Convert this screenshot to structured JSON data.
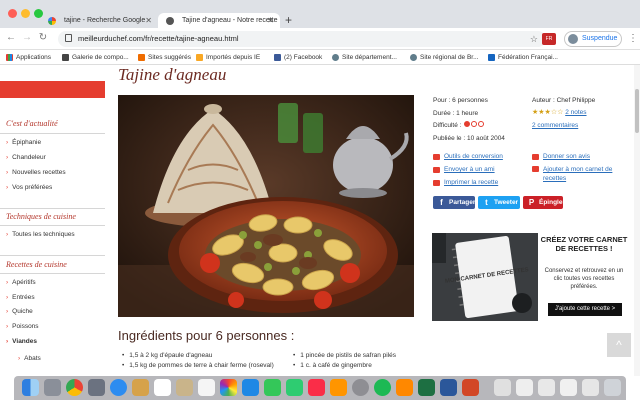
{
  "browser": {
    "tabs": [
      {
        "title": "tajine - Recherche Google",
        "active": false
      },
      {
        "title": "Tajine d'agneau - Notre recette",
        "active": true
      }
    ],
    "new_tab": "+",
    "url": "meilleurduchef.com/fr/recette/tajine-agneau.html",
    "profile_label": "Suspendue",
    "extension_badge": "FR",
    "bookmarks": [
      "Applications",
      "Galerie de compo...",
      "Sites suggérés",
      "Importés depuis IE",
      "(2) Facebook",
      "Site département...",
      "Site régional de Br...",
      "Fédération Françai..."
    ]
  },
  "sidebar": {
    "sections": [
      {
        "title": "C'est d'actualité",
        "items": [
          "Épiphanie",
          "Chandeleur",
          "Nouvelles recettes",
          "Vos préférées"
        ]
      },
      {
        "title": "Techniques de cuisine",
        "items": [
          "Toutes les techniques"
        ]
      },
      {
        "title": "Recettes de cuisine",
        "items": [
          "Apéritifs",
          "Entrées",
          "Quiche",
          "Poissons",
          "Viandes"
        ],
        "subitems": [
          "Abats"
        ]
      }
    ]
  },
  "recipe": {
    "title": "Tajine d'agneau",
    "servings": "Pour : 6 personnes",
    "duration": "Durée : 1 heure",
    "difficulty_label": "Difficulté :",
    "difficulty_level": 1,
    "difficulty_max": 3,
    "published": "Publiée le : 10 août 2004",
    "author": "Auteur : Chef Philippe",
    "rating_stars": "★★★☆☆",
    "notes": "2 notes",
    "comments": "2 commentaires",
    "actions_left": [
      "Outils de conversion",
      "Envoyer à un ami",
      "Imprimer la recette"
    ],
    "actions_right": [
      "Donner son avis",
      "Ajouter à mon carnet de recettes"
    ],
    "share": [
      {
        "label": "Partager",
        "icon": "f",
        "color": "#3b5998"
      },
      {
        "label": "Tweeter",
        "icon": "t",
        "color": "#1da1f2"
      },
      {
        "label": "Épingler",
        "icon": "P",
        "color": "#cb2027"
      }
    ]
  },
  "promo": {
    "title": "CRÉEZ VOTRE CARNET DE RECETTES !",
    "text": "Conservez et retrouvez en un clic toutes vos recettes préférées.",
    "button": "J'ajoute cette recette >",
    "notebook_label": "MON CARNET DE RECETTES"
  },
  "ingredients": {
    "title": "Ingrédients pour 6 personnes :",
    "col1": [
      "1,5 à 2 kg d'épaule d'agneau",
      "1,5 kg de pommes de terre à chair ferme (roseval)"
    ],
    "col2": [
      "1 pincée de pistils de safran pilés",
      "1 c. à café de gingembre"
    ]
  },
  "scroll_top": "^"
}
